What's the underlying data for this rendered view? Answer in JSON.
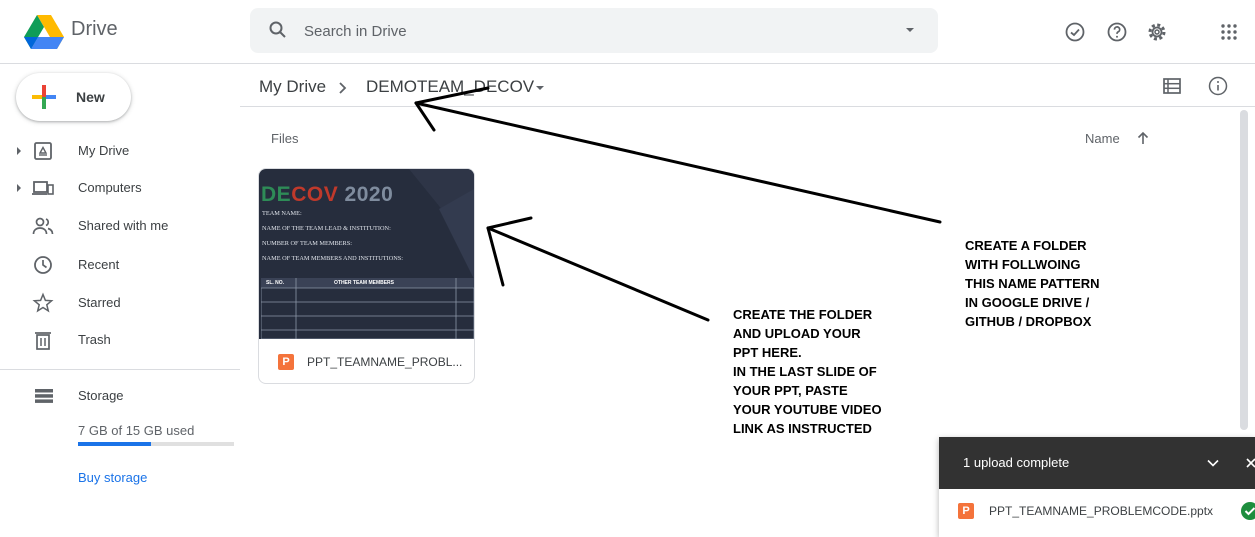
{
  "app": {
    "brand": "Drive"
  },
  "search": {
    "placeholder": "Search in Drive"
  },
  "sidebar": {
    "new_label": "New",
    "items": [
      {
        "label": "My Drive",
        "icon": "my-drive-icon"
      },
      {
        "label": "Computers",
        "icon": "computers-icon"
      },
      {
        "label": "Shared with me",
        "icon": "shared-icon"
      },
      {
        "label": "Recent",
        "icon": "clock-icon"
      },
      {
        "label": "Starred",
        "icon": "star-icon"
      },
      {
        "label": "Trash",
        "icon": "trash-icon"
      }
    ],
    "storage": {
      "label": "Storage",
      "used_text": "7 GB of 15 GB used",
      "used_fraction": 0.47,
      "buy_label": "Buy storage"
    }
  },
  "breadcrumb": {
    "root": "My Drive",
    "current": "DEMOTEAM_DECOV"
  },
  "files": {
    "section_title": "Files",
    "sort_label": "Name",
    "items": [
      {
        "name": "PPT_TEAMNAME_PROBL...",
        "type_badge": "P",
        "thumbnail": {
          "title_de": "DE",
          "title_cov": "COV",
          "title_year": "2020",
          "lines": [
            "TEAM NAME:",
            "NAME OF THE TEAM LEAD & INSTITUTION:",
            "NUMBER OF TEAM MEMBERS:",
            "NAME OF TEAM MEMBERS  AND INSTITUTIONS:"
          ],
          "table_col1": "SL. NO.",
          "table_col2": "OTHER TEAM MEMBERS"
        }
      }
    ]
  },
  "annotations": {
    "folder_note": [
      "CREATE A FOLDER",
      "WITH FOLLWOING",
      "THIS NAME PATTERN",
      "IN GOOGLE DRIVE /",
      "GITHUB / DROPBOX"
    ],
    "upload_note": [
      "CREATE THE FOLDER",
      "AND UPLOAD YOUR",
      "PPT HERE.",
      "IN THE LAST SLIDE OF",
      "YOUR PPT, PASTE",
      "YOUR YOUTUBE VIDEO",
      "LINK AS INSTRUCTED"
    ]
  },
  "upload_toast": {
    "title": "1 upload complete",
    "file_name": "PPT_TEAMNAME_PROBLEMCODE.pptx",
    "badge": "P"
  },
  "colors": {
    "accent_blue": "#1a73e8",
    "ppt_orange": "#f4733b",
    "toast_bg": "#323232",
    "success_green": "#1e8e3e"
  }
}
